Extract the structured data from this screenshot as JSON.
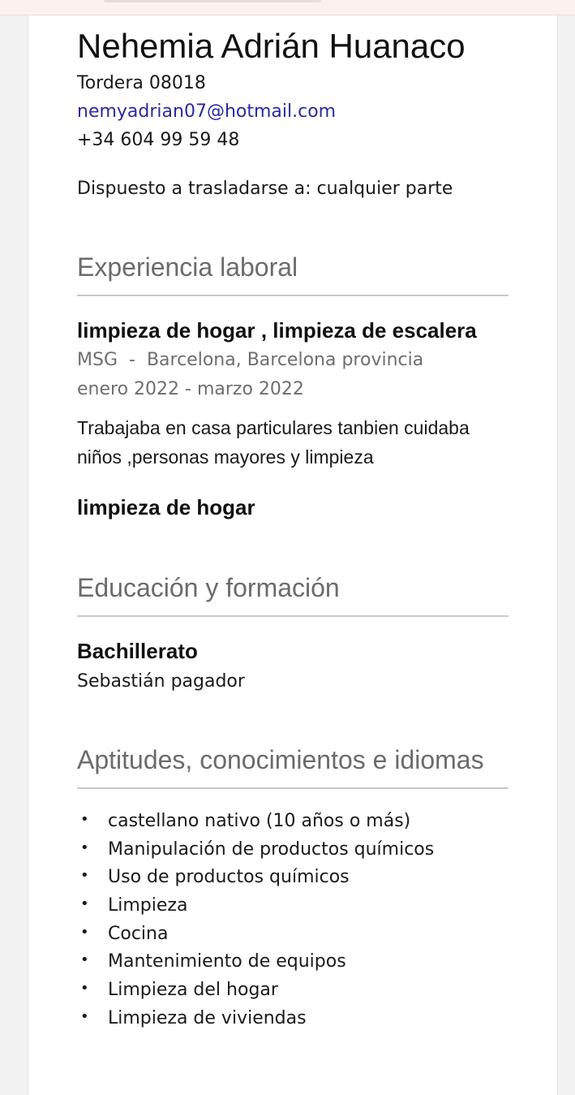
{
  "header": {
    "name": "Nehemia Adrián Huanaco",
    "location": "Tordera 08018",
    "email": "nemyadrian07@hotmail.com",
    "phone": "+34 604 99 59 48",
    "relocation": "Dispuesto a trasladarse a: cualquier parte"
  },
  "experience": {
    "title": "Experiencia laboral",
    "jobs": [
      {
        "title": "limpieza de hogar , limpieza de escalera",
        "company": "MSG",
        "separator": "-",
        "location": "Barcelona, Barcelona provincia",
        "dates": "enero 2022 - marzo 2022",
        "description": "Trabajaba en casa particulares tanbien cuidaba niños ,personas mayores y limpieza"
      },
      {
        "title": "limpieza de hogar"
      }
    ]
  },
  "education": {
    "title": "Educación y formación",
    "degree": "Bachillerato",
    "school": "Sebastián pagador"
  },
  "skills": {
    "title": "Aptitudes, conocimientos e idiomas",
    "bullet": "•",
    "items": [
      "castellano nativo (10 años o más)",
      "Manipulación de productos químicos",
      "Uso de productos químicos",
      "Limpieza",
      "Cocina",
      "Mantenimiento de equipos",
      "Limpieza del hogar",
      "Limpieza de viviendas"
    ]
  }
}
